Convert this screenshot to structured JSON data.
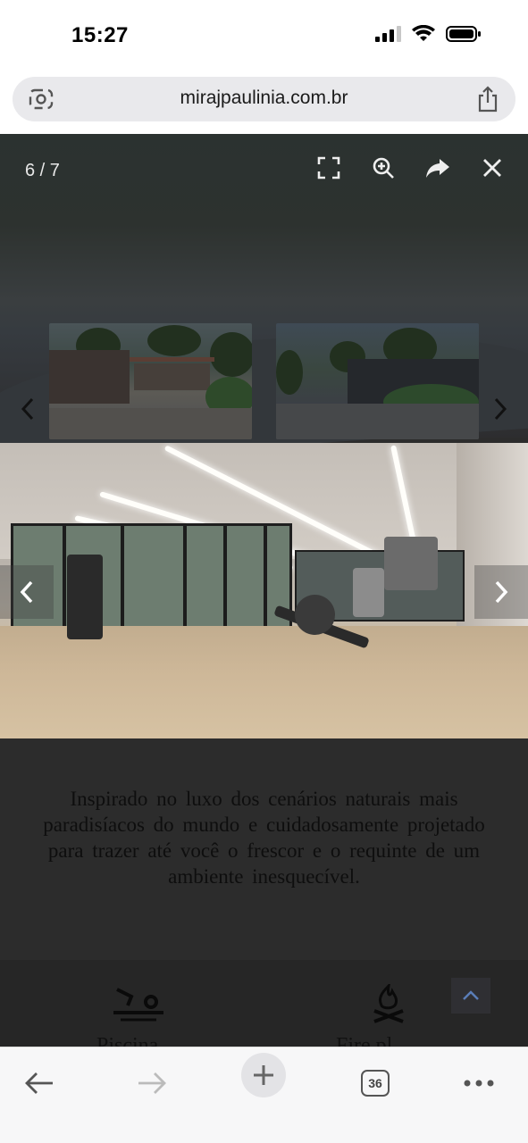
{
  "status_bar": {
    "time": "15:27"
  },
  "browser": {
    "url": "mirajpaulinia.com.br",
    "tab_count": "36"
  },
  "lightbox": {
    "counter": "6 / 7"
  },
  "content": {
    "tagline": "Inspirado no luxo dos cenários naturais mais paradisíacos do mundo e cuidadosamente projetado para trazer até você o frescor e o requinte de um ambiente inesquecível.",
    "amenities": [
      {
        "label": "Piscina",
        "icon": "swimmer-icon"
      },
      {
        "label": "Fire pl",
        "icon": "fire-pit-icon"
      }
    ]
  },
  "colors": {
    "overlay": "#2c2c2c",
    "toolbar": "#f7f7f8",
    "url_bar": "#e9e9ec"
  }
}
